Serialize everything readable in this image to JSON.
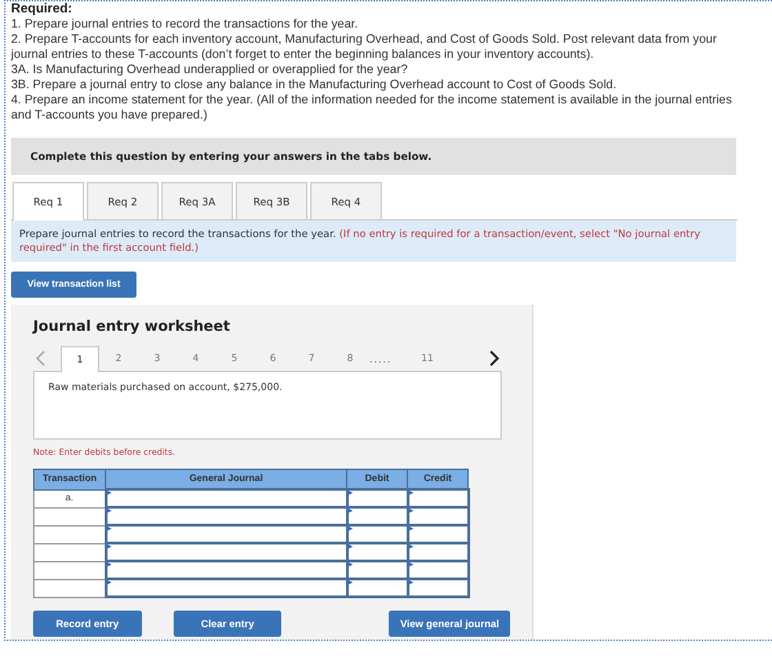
{
  "heading": "Required:",
  "instructions": [
    "1. Prepare journal entries to record the transactions for the year.",
    "2. Prepare T-accounts for each inventory account, Manufacturing Overhead, and Cost of Goods Sold. Post relevant data from your journal entries to these T-accounts (don’t forget to enter the beginning balances in your inventory accounts).",
    "3A. Is Manufacturing Overhead underapplied or overapplied for the year?",
    "3B. Prepare a journal entry to close any balance in the Manufacturing Overhead account to Cost of Goods Sold.",
    "4. Prepare an income statement for the year. (All of the information needed for the income statement is available in the journal entries and T-accounts you have prepared.)"
  ],
  "banner": "Complete this question by entering your answers in the tabs below.",
  "tabs": [
    {
      "label": "Req 1",
      "selected": true
    },
    {
      "label": "Req 2",
      "selected": false
    },
    {
      "label": "Req 3A",
      "selected": false
    },
    {
      "label": "Req 3B",
      "selected": false
    },
    {
      "label": "Req 4",
      "selected": false
    }
  ],
  "prompt": {
    "text": "Prepare journal entries to record the transactions for the year.",
    "note": "(If no entry is required for a transaction/event, select \"No journal entry required\" in the first account field.)"
  },
  "view_list_button": "View transaction list",
  "worksheet": {
    "title": "Journal entry worksheet",
    "pages": [
      {
        "kind": "page",
        "label": "1",
        "selected": true
      },
      {
        "kind": "page",
        "label": "2",
        "selected": false
      },
      {
        "kind": "page",
        "label": "3",
        "selected": false
      },
      {
        "kind": "page",
        "label": "4",
        "selected": false
      },
      {
        "kind": "page",
        "label": "5",
        "selected": false
      },
      {
        "kind": "page",
        "label": "6",
        "selected": false
      },
      {
        "kind": "page",
        "label": "7",
        "selected": false
      },
      {
        "kind": "page",
        "label": "8",
        "selected": false
      },
      {
        "kind": "gap",
        "label": "....."
      },
      {
        "kind": "page",
        "label": "11",
        "selected": false
      }
    ],
    "description": "Raw materials purchased on account, $275,000.",
    "note": "Note: Enter debits before credits.",
    "columns": [
      "Transaction",
      "General Journal",
      "Debit",
      "Credit"
    ],
    "rows": [
      {
        "transaction": "a."
      },
      {},
      {},
      {},
      {},
      {}
    ],
    "buttons": [
      "Record entry",
      "Clear entry",
      "View general journal"
    ]
  }
}
